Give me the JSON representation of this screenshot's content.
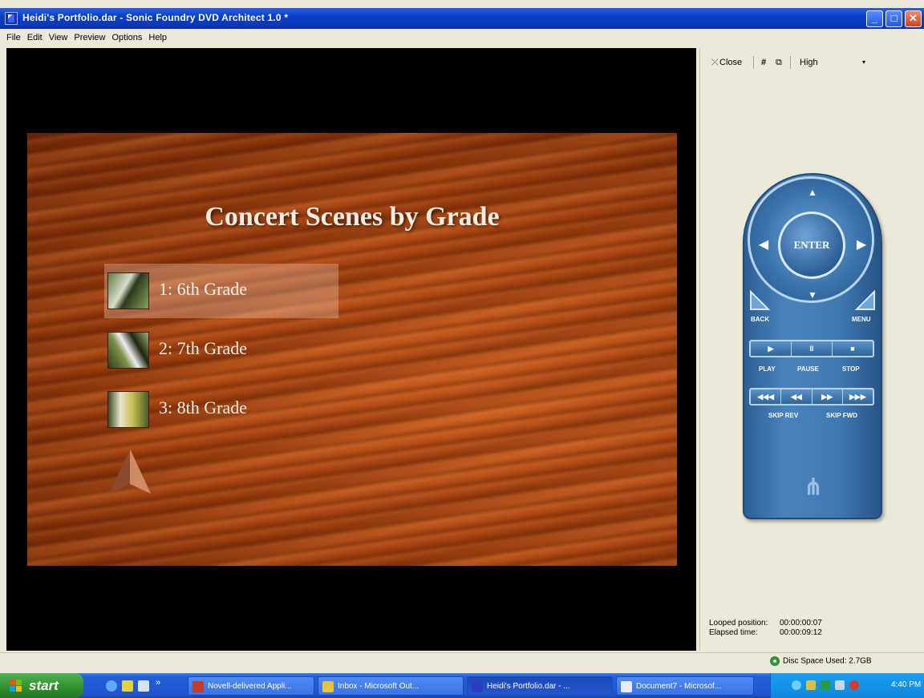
{
  "window": {
    "title": "Heidi's Portfolio.dar - Sonic Foundry DVD Architect 1.0 *",
    "minimize": "_",
    "maximize": "□",
    "close": "✕"
  },
  "menu": [
    "File",
    "Edit",
    "View",
    "Preview",
    "Options",
    "Help"
  ],
  "preview": {
    "title": "Concert Scenes by Grade",
    "scenes": [
      {
        "label": "1: 6th Grade",
        "highlighted": true
      },
      {
        "label": "2: 7th Grade",
        "highlighted": false
      },
      {
        "label": "3: 8th Grade",
        "highlighted": false
      }
    ]
  },
  "panel_toolbar": {
    "close_label": "Close",
    "quality": "High",
    "dropdown_arrow": "▾"
  },
  "remote": {
    "enter": "ENTER",
    "up": "▲",
    "down": "▼",
    "left": "◀",
    "right": "▶",
    "back": "BACK",
    "menu": "MENU",
    "play": "PLAY",
    "pause": "PAUSE",
    "stop": "STOP",
    "play_glyph": "▶",
    "pause_glyph": "II",
    "stop_glyph": "■",
    "skip_rev_glyph": "◀◀◀",
    "rev_glyph": "◀◀",
    "fwd_glyph": "▶▶",
    "skip_fwd_glyph": "▶▶▶",
    "skip_rev": "SKIP REV",
    "skip_fwd": "SKIP FWD"
  },
  "readout": {
    "looped_label": "Looped position:",
    "looped_value": "00:00:00:07",
    "elapsed_label": "Elapsed time:",
    "elapsed_value": "00:00:09:12"
  },
  "status": {
    "disc_space": "Disc Space Used: 2.7GB"
  },
  "taskbar": {
    "start": "start",
    "overflow": "»",
    "tasks": [
      {
        "label": "Novell-delivered Appli...",
        "active": false
      },
      {
        "label": "Inbox - Microsoft Out...",
        "active": false
      },
      {
        "label": "Heidi's Portfolio.dar - ...",
        "active": true
      },
      {
        "label": "Document7 - Microsof...",
        "active": false
      }
    ],
    "clock": "4:40 PM"
  }
}
